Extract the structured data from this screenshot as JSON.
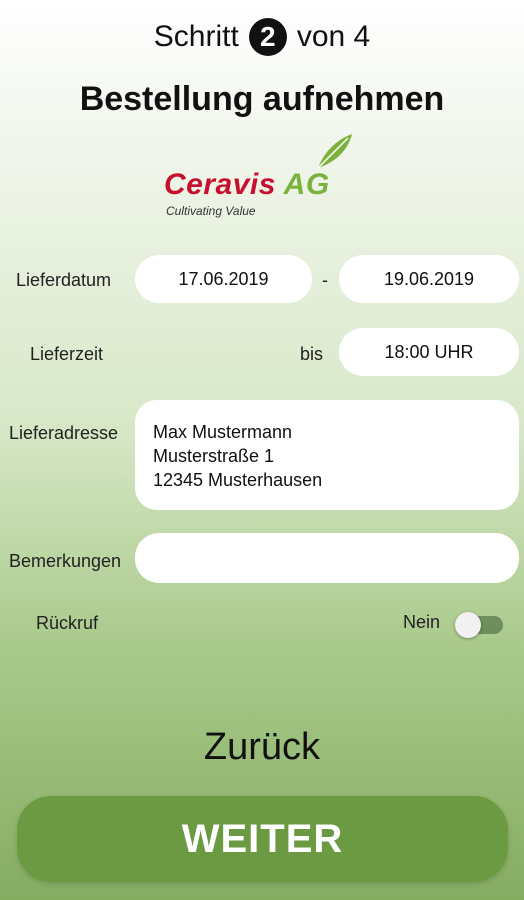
{
  "header": {
    "step_prefix": "Schritt",
    "step_number": "2",
    "step_suffix": "von 4",
    "title": "Bestellung aufnehmen"
  },
  "logo": {
    "brand": "Ceravis",
    "suffix": "AG",
    "tagline": "Cultivating Value",
    "brand_color": "#c8102e",
    "leaf_color": "#7bb13c"
  },
  "form": {
    "delivery_date_label": "Lieferdatum",
    "date_from": "17.06.2019",
    "date_separator": "-",
    "date_to": "19.06.2019",
    "delivery_time_label": "Lieferzeit",
    "time_until_label": "bis",
    "time_value": "18:00 UHR",
    "address_label": "Lieferadresse",
    "address_line1": "Max Mustermann",
    "address_line2": "Musterstraße 1",
    "address_line3": "12345 Musterhausen",
    "remarks_label": "Bemerkungen",
    "remarks_value": "",
    "callback_label": "Rückruf",
    "callback_state_label": "Nein",
    "callback_enabled": false
  },
  "actions": {
    "back_label": "Zurück",
    "next_label": "WEITER",
    "next_color": "#6b9a43"
  }
}
